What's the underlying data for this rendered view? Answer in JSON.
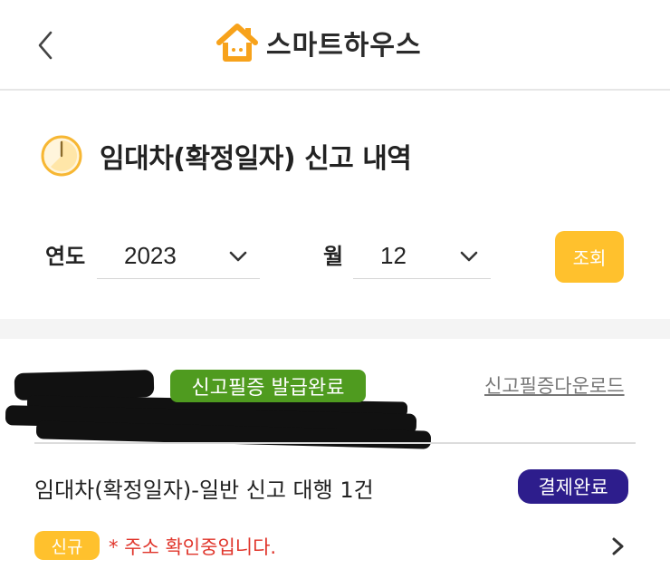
{
  "header": {
    "back_icon": "chevron-left-icon",
    "logo_icon": "house-icon",
    "logo_text": "스마트하우스",
    "accent_color": "#f7a21b"
  },
  "page": {
    "title_icon": "clock-icon",
    "title": "임대차(확정일자) 신고 내역"
  },
  "filter": {
    "year_label": "연도",
    "year_value": "2023",
    "month_label": "월",
    "month_value": "12",
    "search_label": "조회",
    "button_color": "#ffc12d"
  },
  "card": {
    "status_badge": "신고필증 발급완료",
    "status_color": "#4f9b1f",
    "download_link": "신고필증다운로드",
    "service_title": "임대차(확정일자)-일반 신고 대행 1건",
    "payment_badge": "결제완료",
    "payment_color": "#2d1d8c",
    "new_badge": "신규",
    "notice": "* 주소 확인중입니다.",
    "notice_color": "#e0342a",
    "arrow_icon": "chevron-right-icon"
  }
}
